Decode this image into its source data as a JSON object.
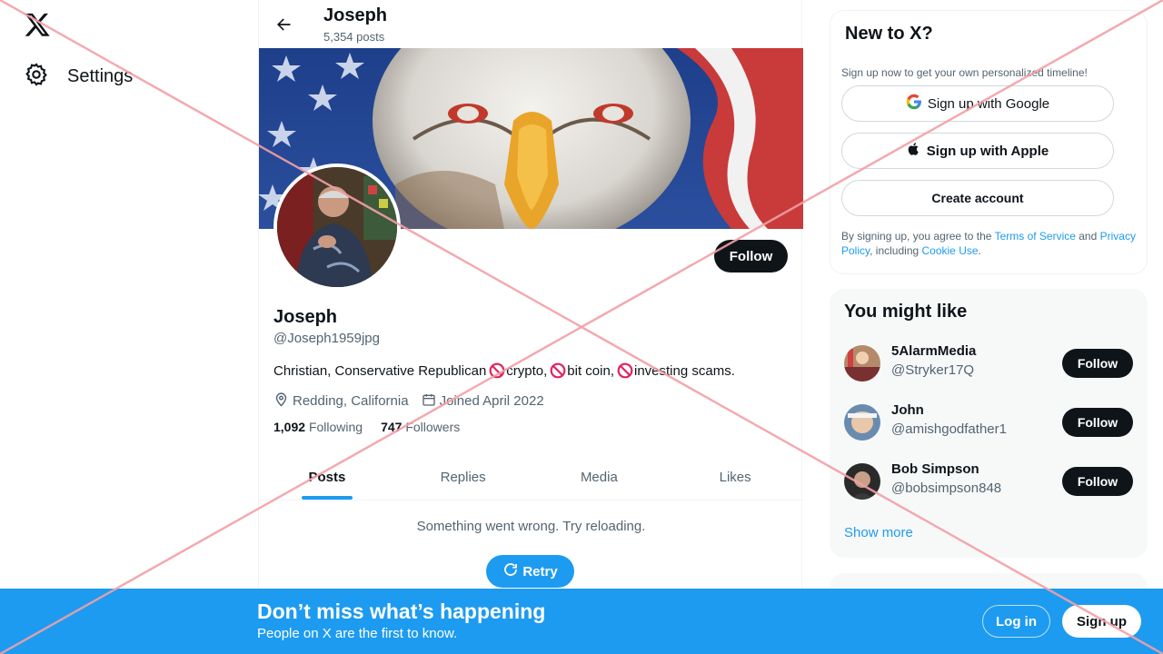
{
  "leftnav": {
    "logo_icon": "x-logo-icon",
    "settings_label": "Settings"
  },
  "header": {
    "name": "Joseph",
    "posts_count": "5,354 posts"
  },
  "profile": {
    "name": "Joseph",
    "handle": "@Joseph1959jpg",
    "follow_label": "Follow",
    "bio_parts": [
      "Christian, Conservative Republican ",
      "crypto, ",
      "bit coin, ",
      "investing scams."
    ],
    "location": "Redding, California",
    "joined": "Joined April 2022",
    "following_count": "1,092",
    "following_label": "Following",
    "followers_count": "747",
    "followers_label": "Followers"
  },
  "tabs": [
    "Posts",
    "Replies",
    "Media",
    "Likes"
  ],
  "active_tab": "Posts",
  "feed": {
    "error": "Something went wrong. Try reloading.",
    "retry_label": "Retry"
  },
  "new_to_x": {
    "title": "New to X?",
    "subtitle": "Sign up now to get your own personalized timeline!",
    "google_label": "Sign up with Google",
    "apple_label": "Sign up with Apple",
    "create_label": "Create account",
    "terms_prefix": "By signing up, you agree to the ",
    "terms_link": "Terms of Service",
    "terms_and": " and ",
    "privacy_link": "Privacy Policy",
    "terms_including": ", including ",
    "cookie_link": "Cookie Use",
    "terms_end": "."
  },
  "you_might_like": {
    "title": "You might like",
    "items": [
      {
        "name": "5AlarmMedia",
        "handle": "@Stryker17Q",
        "follow": "Follow"
      },
      {
        "name": "John",
        "handle": "@amishgodfather1",
        "follow": "Follow"
      },
      {
        "name": "Bob Simpson",
        "handle": "@bobsimpson848",
        "follow": "Follow"
      }
    ],
    "show_more": "Show more"
  },
  "bottom_bar": {
    "title": "Don’t miss what’s happening",
    "subtitle": "People on X are the first to know.",
    "login_label": "Log in",
    "signup_label": "Sign up"
  },
  "colors": {
    "accent": "#1d9bf0",
    "text": "#0f1419",
    "secondary": "#536471",
    "no_symbol": "#e0245e",
    "overlay_cross": "#f2a0a6"
  }
}
